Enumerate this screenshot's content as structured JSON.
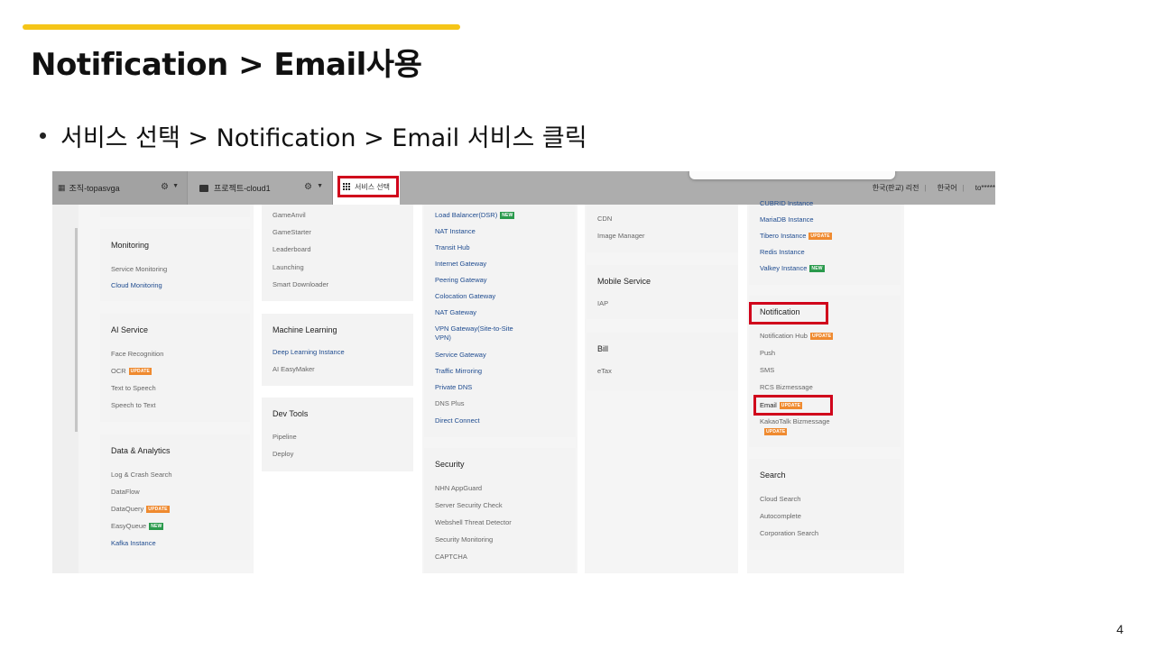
{
  "slide": {
    "title": "Notification  >  Email사용",
    "bullet": "서비스 선택 > Notification > Email 서비스 클릭",
    "page_number": "4"
  },
  "colors": {
    "accent": "#f5c518",
    "highlight": "#d0021b",
    "link": "#1e4b8f",
    "update_badge": "#ef8a2f",
    "new_badge": "#2a9a4c"
  },
  "topbar": {
    "org_label": "조직-topasvga",
    "project_label": "프로젝트-cloud1",
    "service_select_label": "서비스 선택",
    "region": "한국(판교) 리전",
    "language": "한국어",
    "user": "to*****",
    "org_icon": "grid-icon",
    "project_icon": "folder-icon",
    "gear_icon": "gear-icon",
    "caret_icon": "chevron-down-icon"
  },
  "badges": {
    "update": "UPDATE",
    "new": "NEW"
  },
  "columns": {
    "col1": {
      "monitoring": {
        "title": "Monitoring",
        "items": [
          "Service Monitoring",
          "Cloud Monitoring"
        ]
      },
      "ai_service": {
        "title": "AI Service",
        "items": [
          "Face Recognition",
          "OCR",
          "Text to Speech",
          "Speech to Text"
        ]
      },
      "data_analytics": {
        "title": "Data & Analytics",
        "items": [
          "Log & Crash Search",
          "DataFlow",
          "DataQuery",
          "EasyQueue",
          "Kafka Instance"
        ]
      }
    },
    "col2": {
      "game": {
        "items": [
          "GameAnvil",
          "GameStarter",
          "Leaderboard",
          "Launching",
          "Smart Downloader"
        ]
      },
      "machine_learning": {
        "title": "Machine Learning",
        "items": [
          "Deep Learning Instance",
          "AI EasyMaker"
        ]
      },
      "dev_tools": {
        "title": "Dev Tools",
        "items": [
          "Pipeline",
          "Deploy"
        ]
      }
    },
    "col3": {
      "network": {
        "items": [
          "Load Balancer(DSR)",
          "NAT Instance",
          "Transit Hub",
          "Internet Gateway",
          "Peering Gateway",
          "Colocation Gateway",
          "NAT Gateway",
          "VPN Gateway(Site-to-Site",
          "VPN)",
          "Service Gateway",
          "Traffic Mirroring",
          "Private DNS",
          "DNS Plus",
          "Direct Connect"
        ]
      },
      "security": {
        "title": "Security",
        "items": [
          "NHN AppGuard",
          "Server Security Check",
          "Webshell Threat Detector",
          "Security Monitoring",
          "CAPTCHA"
        ]
      }
    },
    "col4": {
      "cdn": {
        "items": [
          "CDN",
          "Image Manager"
        ]
      },
      "mobile_service": {
        "title": "Mobile Service",
        "items": [
          "IAP"
        ]
      },
      "bill": {
        "title": "Bill",
        "items": [
          "eTax"
        ]
      }
    },
    "col5": {
      "database": {
        "items": [
          "CUBRID Instance",
          "MariaDB Instance",
          "Tibero Instance",
          "Redis Instance",
          "Valkey Instance"
        ]
      },
      "notification": {
        "title": "Notification",
        "items": [
          "Notification Hub",
          "Push",
          "SMS",
          "RCS Bizmessage",
          "Email",
          "KakaoTalk Bizmessage"
        ]
      },
      "search": {
        "title": "Search",
        "items": [
          "Cloud Search",
          "Autocomplete",
          "Corporation Search"
        ]
      }
    }
  }
}
